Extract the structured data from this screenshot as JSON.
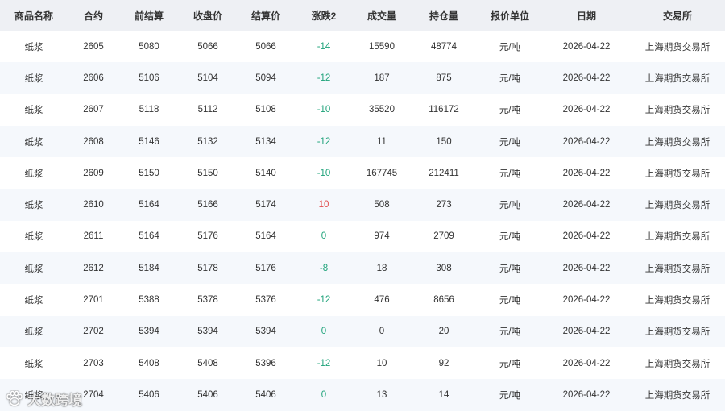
{
  "table": {
    "columns": [
      "商品名称",
      "合约",
      "前结算",
      "收盘价",
      "结算价",
      "涨跌2",
      "成交量",
      "持仓量",
      "报价单位",
      "日期",
      "交易所"
    ],
    "rows": [
      [
        "纸浆",
        "2605",
        "5080",
        "5066",
        "5066",
        "-14",
        "15590",
        "48774",
        "元/吨",
        "2026-04-22",
        "上海期货交易所"
      ],
      [
        "纸浆",
        "2606",
        "5106",
        "5104",
        "5094",
        "-12",
        "187",
        "875",
        "元/吨",
        "2026-04-22",
        "上海期货交易所"
      ],
      [
        "纸浆",
        "2607",
        "5118",
        "5112",
        "5108",
        "-10",
        "35520",
        "116172",
        "元/吨",
        "2026-04-22",
        "上海期货交易所"
      ],
      [
        "纸浆",
        "2608",
        "5146",
        "5132",
        "5134",
        "-12",
        "11",
        "150",
        "元/吨",
        "2026-04-22",
        "上海期货交易所"
      ],
      [
        "纸浆",
        "2609",
        "5150",
        "5150",
        "5140",
        "-10",
        "167745",
        "212411",
        "元/吨",
        "2026-04-22",
        "上海期货交易所"
      ],
      [
        "纸浆",
        "2610",
        "5164",
        "5166",
        "5174",
        "10",
        "508",
        "273",
        "元/吨",
        "2026-04-22",
        "上海期货交易所"
      ],
      [
        "纸浆",
        "2611",
        "5164",
        "5176",
        "5164",
        "0",
        "974",
        "2709",
        "元/吨",
        "2026-04-22",
        "上海期货交易所"
      ],
      [
        "纸浆",
        "2612",
        "5184",
        "5178",
        "5176",
        "-8",
        "18",
        "308",
        "元/吨",
        "2026-04-22",
        "上海期货交易所"
      ],
      [
        "纸浆",
        "2701",
        "5388",
        "5378",
        "5376",
        "-12",
        "476",
        "8656",
        "元/吨",
        "2026-04-22",
        "上海期货交易所"
      ],
      [
        "纸浆",
        "2702",
        "5394",
        "5394",
        "5394",
        "0",
        "0",
        "20",
        "元/吨",
        "2026-04-22",
        "上海期货交易所"
      ],
      [
        "纸浆",
        "2703",
        "5408",
        "5408",
        "5396",
        "-12",
        "10",
        "92",
        "元/吨",
        "2026-04-22",
        "上海期货交易所"
      ],
      [
        "纸浆",
        "2704",
        "5406",
        "5406",
        "5406",
        "0",
        "13",
        "14",
        "元/吨",
        "2026-04-22",
        "上海期货交易所"
      ]
    ]
  },
  "colors": {
    "header_bg": "#eef0f4",
    "stripe_bg": "#f5f8fc",
    "negative": "#1fa37a",
    "positive": "#e24d4d",
    "text": "#333333"
  },
  "watermark": {
    "icon": "paw-icon",
    "text": "大数跨境"
  }
}
